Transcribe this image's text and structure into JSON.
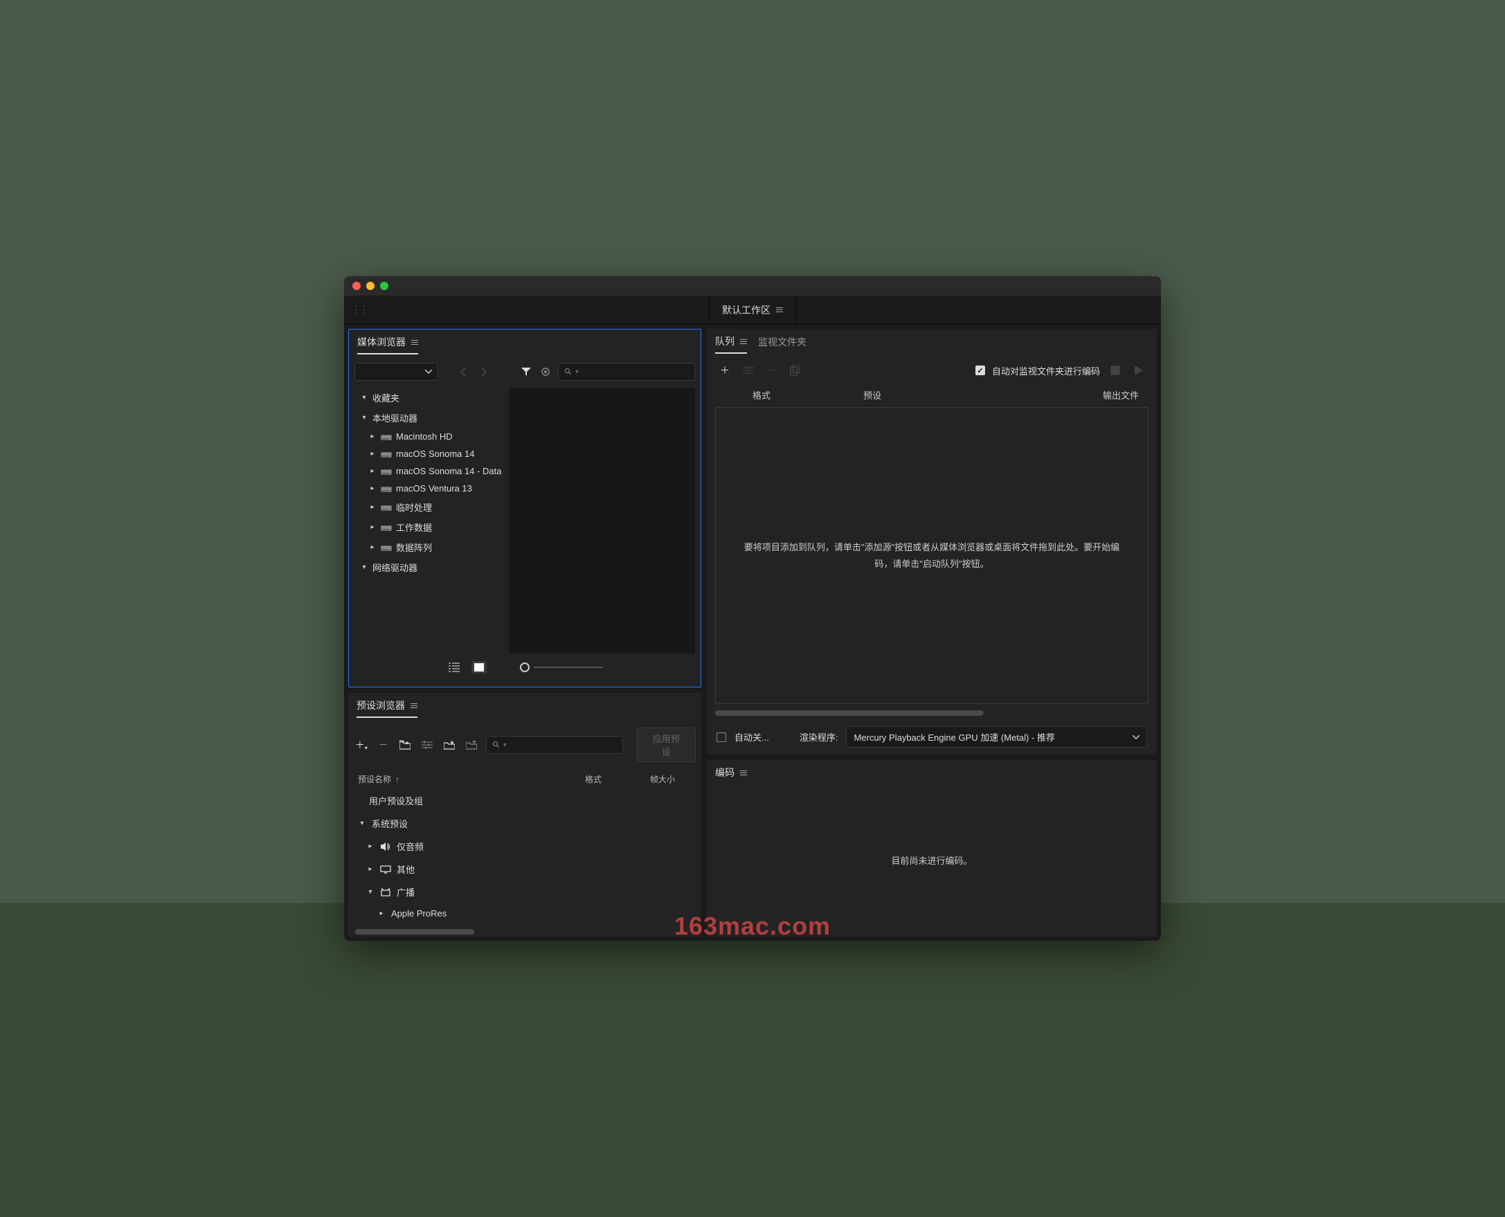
{
  "workspace": {
    "label": "默认工作区"
  },
  "media_browser": {
    "title": "媒体浏览器",
    "search_placeholder": "",
    "tree": {
      "favorites": "收藏夹",
      "local_drives": "本地驱动器",
      "drives": [
        "Macintosh HD",
        "macOS Sonoma 14",
        "macOS Sonoma 14 - Data",
        "macOS Ventura 13",
        "临时处理",
        "工作数据",
        "数据阵列"
      ],
      "network_drives": "网络驱动器"
    }
  },
  "preset_browser": {
    "title": "预设浏览器",
    "apply_label": "应用预设",
    "columns": {
      "name": "预设名称",
      "format": "格式",
      "frame_size": "帧大小"
    },
    "rows": {
      "user_presets": "用户预设及组",
      "system_presets": "系统预设",
      "audio_only": "仅音频",
      "other": "其他",
      "broadcast": "广播",
      "apple_prores": "Apple ProRes"
    }
  },
  "queue": {
    "tab_queue": "队列",
    "tab_watch": "监视文件夹",
    "auto_encode_label": "自动对监视文件夹进行编码",
    "headers": {
      "format": "格式",
      "preset": "预设",
      "output": "输出文件"
    },
    "empty_msg": "要将项目添加到队列，请单击\"添加源\"按钮或者从媒体浏览器或桌面将文件拖到此处。要开始编码，请单击\"启动队列\"按钮。",
    "auto_close_label": "自动关...",
    "renderer_label": "渲染程序:",
    "renderer_value": "Mercury Playback Engine GPU 加速 (Metal) - 推荐"
  },
  "encoding": {
    "title": "编码",
    "msg": "目前尚未进行编码。"
  },
  "watermark": "163mac.com"
}
